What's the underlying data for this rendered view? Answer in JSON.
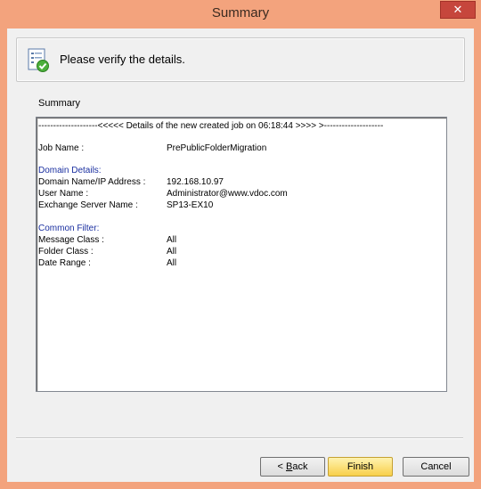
{
  "window": {
    "title": "Summary",
    "close_label": "✕",
    "colors": {
      "frame": "#f3a37d",
      "close": "#c6463c"
    }
  },
  "header": {
    "icon": "checklist-checkmark-icon",
    "text": "Please verify the details."
  },
  "summary": {
    "label": "Summary",
    "banner": "--------------------<<<<< Details of the new created job on 06:18:44 >>>> >--------------------",
    "job_name_label": "Job Name :",
    "job_name_value": "PrePublicFolderMigration",
    "domain_section": "Domain Details:",
    "domain_label": "Domain Name/IP Address :",
    "domain_value": "192.168.10.97",
    "user_label": "User Name :",
    "user_value": "Administrator@www.vdoc.com",
    "exchange_label": "Exchange Server Name :",
    "exchange_value": "SP13-EX10",
    "filter_section": "Common Filter:",
    "message_class_label": "Message Class :",
    "message_class_value": "All",
    "folder_class_label": "Folder Class :",
    "folder_class_value": "All",
    "date_range_label": "Date Range :",
    "date_range_value": "All"
  },
  "buttons": {
    "back_prefix": "< ",
    "back_accel": "B",
    "back_rest": "ack",
    "finish": "Finish",
    "cancel": "Cancel"
  }
}
